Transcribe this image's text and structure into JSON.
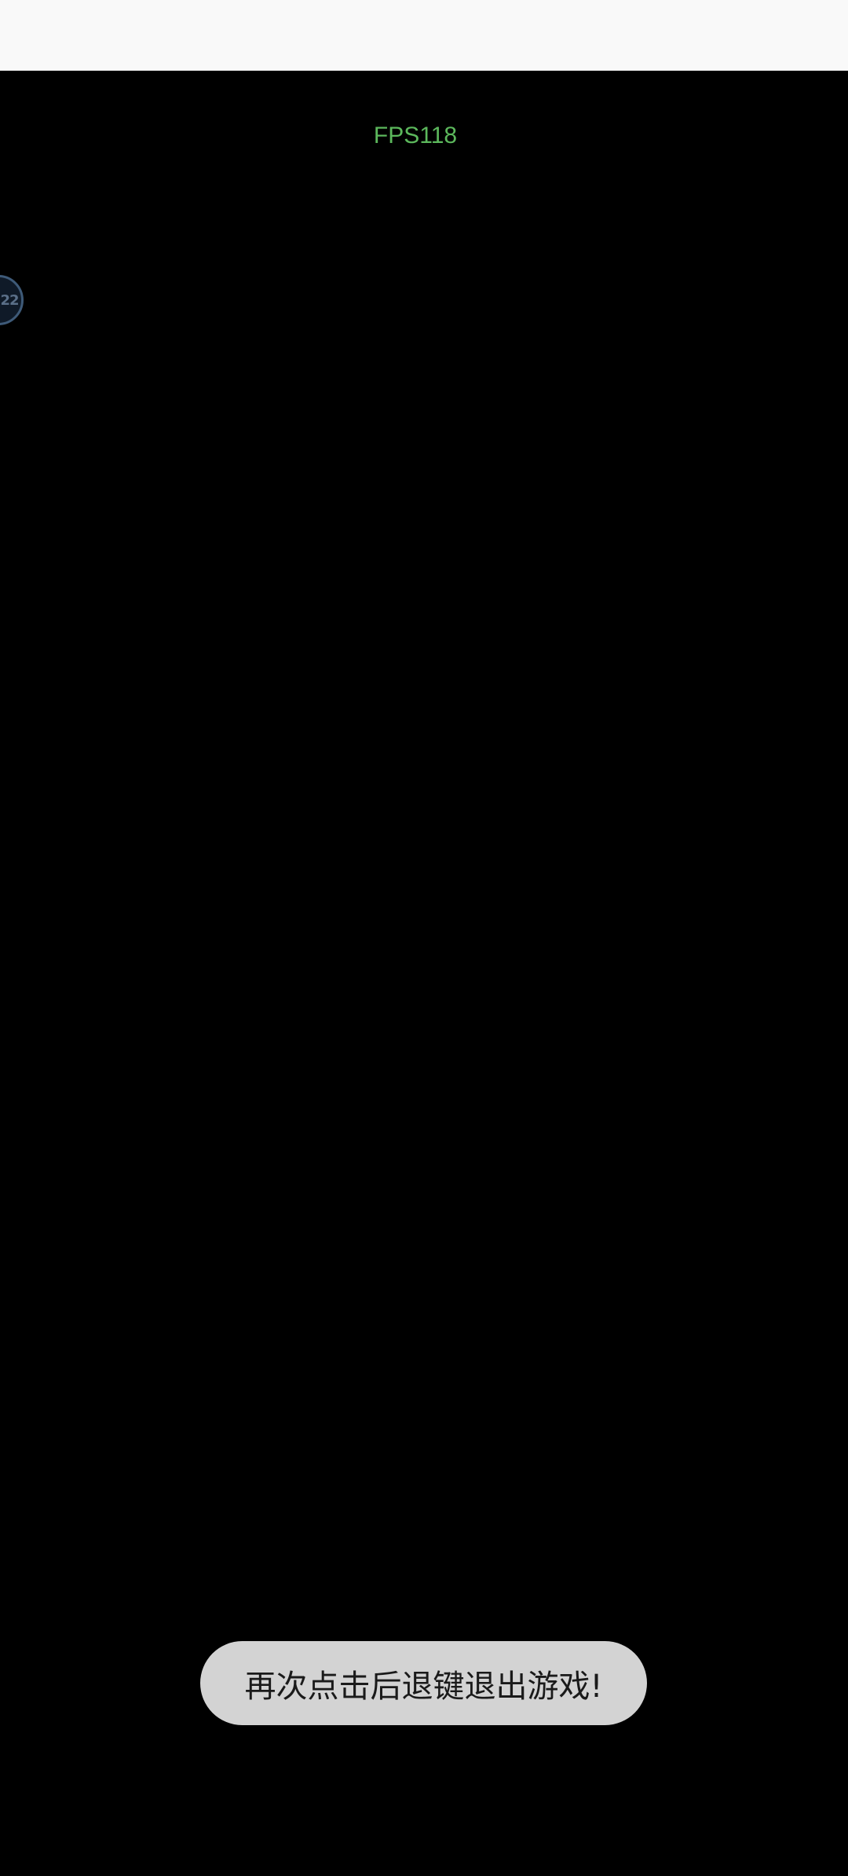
{
  "status_bar": {},
  "game": {
    "fps_label": "FPS118",
    "float_ball_label": "22"
  },
  "toast": {
    "message": "再次点击后退键退出游戏!"
  },
  "colors": {
    "background": "#000000",
    "status_bar": "#f9f9f9",
    "fps_text": "#5cb85c",
    "toast_bg": "#d3d3d3",
    "float_ball_border": "#3e5a78"
  }
}
